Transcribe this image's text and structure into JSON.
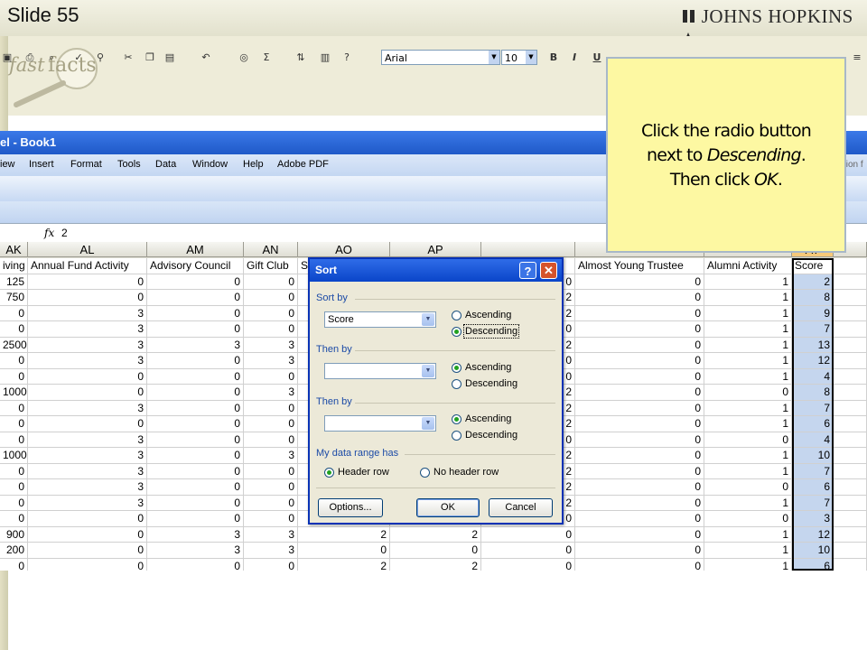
{
  "slide": {
    "number_label": "Slide 55",
    "logo_text": "JOHNS HOPKINS",
    "fastfacts_left": "fast",
    "fastfacts_right": "facts"
  },
  "excel": {
    "title": "el - Book1",
    "menus": [
      "iew",
      "Insert",
      "Format",
      "Tools",
      "Data",
      "Window",
      "Help",
      "Adobe PDF"
    ],
    "menu_hint": "tion f",
    "font_name": "Arial",
    "font_size": "10",
    "bold": "B",
    "italic": "I",
    "underline": "U",
    "formula_value": "2",
    "fx": "fx",
    "column_letters": [
      "AK",
      "AL",
      "AM",
      "AN",
      "AO",
      "AP",
      "",
      "",
      "",
      "AT"
    ],
    "headers": [
      "iving",
      "Annual Fund Activity",
      "Advisory Council",
      "Gift Club",
      "S",
      "",
      "y",
      "Almost Young Trustee",
      "Alumni Activity",
      "Score"
    ],
    "rows": [
      [
        "125",
        "0",
        "0",
        "0",
        "",
        "",
        "0",
        "0",
        "1",
        "2"
      ],
      [
        "750",
        "0",
        "0",
        "0",
        "",
        "",
        "2",
        "0",
        "1",
        "8"
      ],
      [
        "0",
        "3",
        "0",
        "0",
        "",
        "",
        "2",
        "0",
        "1",
        "9"
      ],
      [
        "0",
        "3",
        "0",
        "0",
        "",
        "",
        "0",
        "0",
        "1",
        "7"
      ],
      [
        "2500",
        "3",
        "3",
        "3",
        "",
        "",
        "2",
        "0",
        "1",
        "13"
      ],
      [
        "0",
        "3",
        "0",
        "3",
        "",
        "",
        "0",
        "0",
        "1",
        "12"
      ],
      [
        "0",
        "0",
        "0",
        "0",
        "",
        "",
        "0",
        "0",
        "1",
        "4"
      ],
      [
        "1000",
        "0",
        "0",
        "3",
        "",
        "",
        "2",
        "0",
        "0",
        "8"
      ],
      [
        "0",
        "3",
        "0",
        "0",
        "",
        "",
        "2",
        "0",
        "1",
        "7"
      ],
      [
        "0",
        "0",
        "0",
        "0",
        "",
        "",
        "2",
        "0",
        "1",
        "6"
      ],
      [
        "0",
        "3",
        "0",
        "0",
        "",
        "",
        "0",
        "0",
        "0",
        "4"
      ],
      [
        "1000",
        "3",
        "0",
        "3",
        "",
        "",
        "2",
        "0",
        "1",
        "10"
      ],
      [
        "0",
        "3",
        "0",
        "0",
        "",
        "",
        "2",
        "0",
        "1",
        "7"
      ],
      [
        "0",
        "3",
        "0",
        "0",
        "",
        "",
        "2",
        "0",
        "0",
        "6"
      ],
      [
        "0",
        "3",
        "0",
        "0",
        "",
        "",
        "2",
        "0",
        "1",
        "7"
      ],
      [
        "0",
        "0",
        "0",
        "0",
        "",
        "",
        "0",
        "0",
        "0",
        "3"
      ],
      [
        "900",
        "0",
        "3",
        "3",
        "2",
        "2",
        "0",
        "0",
        "1",
        "12"
      ],
      [
        "200",
        "0",
        "3",
        "3",
        "0",
        "0",
        "0",
        "0",
        "1",
        "10"
      ],
      [
        "0",
        "0",
        "0",
        "0",
        "2",
        "2",
        "0",
        "0",
        "1",
        "6"
      ]
    ]
  },
  "dialog": {
    "title": "Sort",
    "help": "?",
    "close": "✕",
    "sort_by_label": "Sort by",
    "sort_by_value": "Score",
    "then_by_label_1": "Then by",
    "then_by_label_2": "Then by",
    "ascending": "Ascending",
    "descending": "Descending",
    "range_label": "My data range has",
    "header_row": "Header row",
    "no_header_row": "No header row",
    "options_button": "Options...",
    "ok_button": "OK",
    "cancel_button": "Cancel"
  },
  "callout": {
    "line1": "Click the radio button",
    "line2_pre": "next to ",
    "line2_em": "Descending",
    "line2_post": ".",
    "line3_pre": "Then click ",
    "line3_em": "OK",
    "line3_post": "."
  },
  "colors": {
    "titlebar": "#1f59c8",
    "callout_bg": "#fdf8a2",
    "score_fill": "#c5d6ee",
    "group_label": "#1b4aa6"
  }
}
